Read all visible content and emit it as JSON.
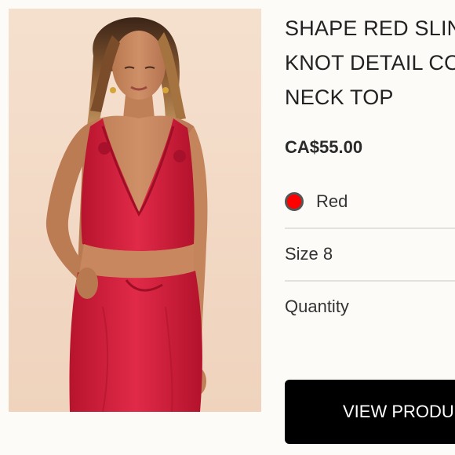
{
  "product": {
    "image_alt": "Model wearing red slinky knot detail cowl neck top and matching skirt",
    "title_lines": [
      "SHAPE RED SLIN",
      "KNOT DETAIL CO",
      "NECK TOP"
    ],
    "price": "CA$55.00",
    "color": {
      "label": "Red",
      "swatch_hex": "#ff0000"
    },
    "size": "Size 8",
    "quantity_label": "Quantity",
    "view_button_label": "VIEW PRODU"
  },
  "colors": {
    "background": "#fdfbf8",
    "image_background": "#f3dcc8",
    "garment": "#d21f3c",
    "button": "#000000"
  }
}
